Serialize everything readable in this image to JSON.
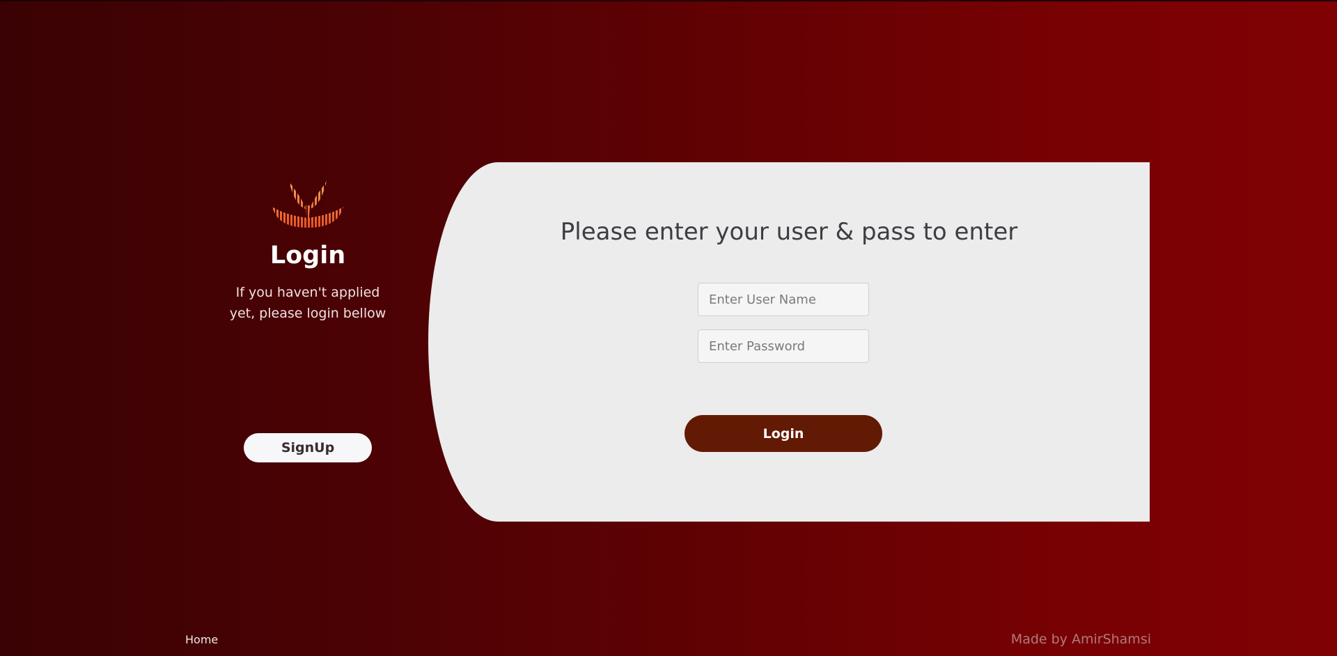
{
  "left": {
    "title": "Login",
    "text": "If you haven't applied yet, please login bellow",
    "signup_label": "SignUp"
  },
  "card": {
    "title": "Please enter your user & pass to enter",
    "username_placeholder": "Enter User Name",
    "password_placeholder": "Enter Password",
    "login_label": "Login"
  },
  "footer": {
    "home_label": "Home",
    "credit": "Made by AmirShamsi"
  },
  "colors": {
    "accent": "#621a04",
    "logo_top": "#f5a05a",
    "logo_bottom": "#e8501c"
  }
}
